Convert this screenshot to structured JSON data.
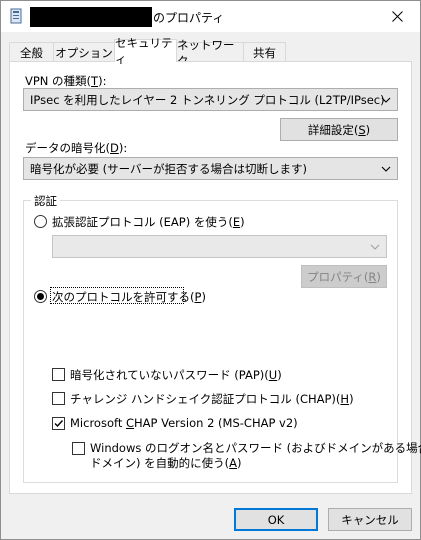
{
  "window": {
    "title_suffix": "のプロパティ"
  },
  "tabs": [
    {
      "label": "全般"
    },
    {
      "label": "オプション"
    },
    {
      "label": "セキュリティ"
    },
    {
      "label": "ネットワーク"
    },
    {
      "label": "共有"
    }
  ],
  "security": {
    "vpn_type_label": "VPN の種類(",
    "vpn_type_key": "T",
    "vpn_type_end": "):",
    "vpn_type_value": "IPsec を利用したレイヤー 2 トンネリング プロトコル (L2TP/IPsec)",
    "advanced_label_a": "詳細設定(",
    "advanced_key": "S",
    "advanced_label_b": ")",
    "encryption_label": "データの暗号化(",
    "encryption_key": "D",
    "encryption_end": "):",
    "encryption_value": "暗号化が必要 (サーバーが拒否する場合は切断します)",
    "auth_group_title": "認証",
    "eap_label": "拡張認証プロトコル (EAP) を使う(",
    "eap_key": "E",
    "eap_end": ")",
    "properties_label_a": "プロパティ(",
    "properties_key": "R",
    "properties_label_b": ")",
    "allow_label": "次のプロトコルを許可する(",
    "allow_key": "P",
    "allow_end": ")",
    "pap_label": "暗号化されていないパスワード (PAP)(",
    "pap_key": "U",
    "pap_end": ")",
    "chap_label": "チャレンジ ハンドシェイク認証プロトコル (CHAP)(",
    "chap_key": "H",
    "chap_end": ")",
    "mschap_label_a": "Microsoft ",
    "mschap_key": "C",
    "mschap_label_b": "HAP Version 2 (MS-CHAP v2)",
    "windows_logon_line1": "Windows のログオン名とパスワード (およびドメインがある場合は",
    "windows_logon_line2": "ドメイン) を自動的に使う(",
    "windows_logon_key": "A",
    "windows_logon_end": ")"
  },
  "buttons": {
    "ok": "OK",
    "cancel": "キャンセル"
  },
  "states": {
    "eap": false,
    "allow": true,
    "pap": false,
    "chap": false,
    "mschap": true,
    "windows_logon": false
  },
  "colors": {
    "accent": "#0078d7",
    "disabled_text": "#838383"
  }
}
